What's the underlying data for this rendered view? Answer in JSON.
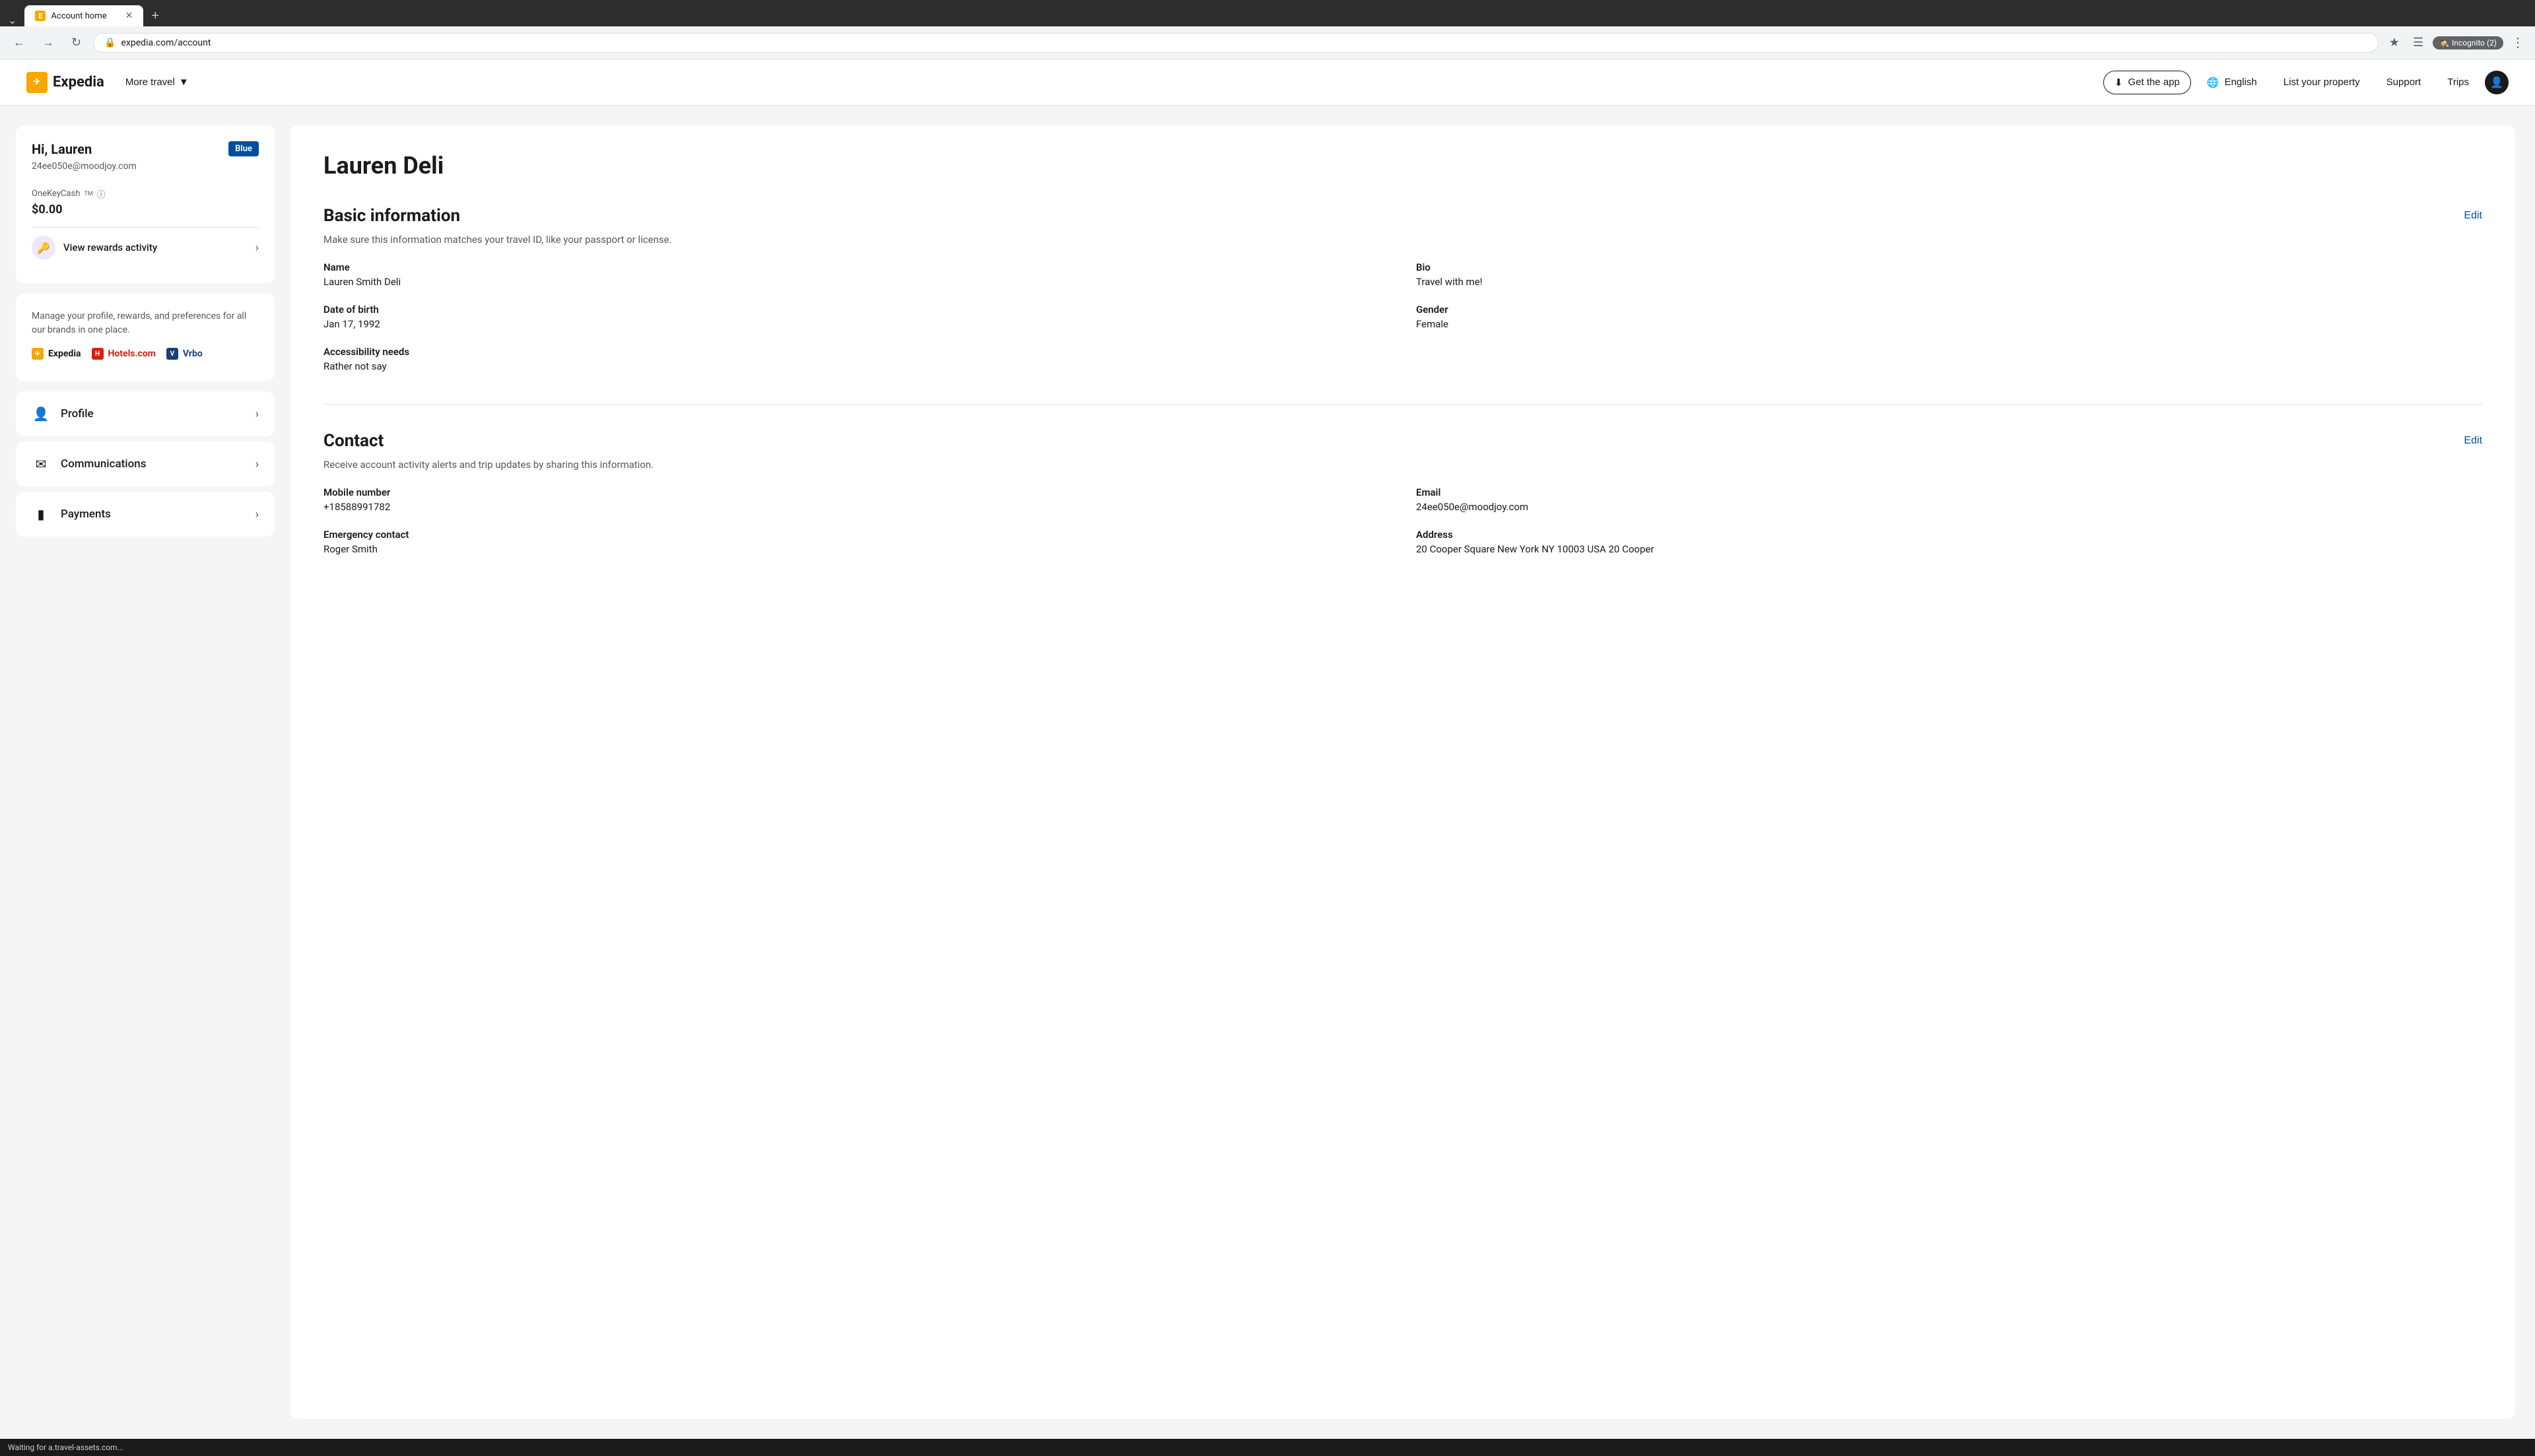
{
  "browser": {
    "tabs": [
      {
        "label": "Account home",
        "active": true,
        "favicon": "E"
      }
    ],
    "url": "expedia.com/account",
    "incognito_label": "Incognito (2)"
  },
  "header": {
    "logo_text": "Expedia",
    "more_travel": "More travel",
    "get_app": "Get the app",
    "language": "English",
    "list_property": "List your property",
    "support": "Support",
    "trips": "Trips"
  },
  "sidebar": {
    "greeting": "Hi, Lauren",
    "email": "24ee050e@moodjoy.com",
    "badge": "Blue",
    "onekeycash_label": "OneKeyCash",
    "onekeycash_amount": "$0.00",
    "rewards_link": "View rewards activity",
    "manage_text": "Manage your profile, rewards, and preferences for all our brands in one place.",
    "brands": [
      "Expedia",
      "Hotels.com",
      "Vrbo"
    ],
    "nav_items": [
      {
        "label": "Profile",
        "icon": "person"
      },
      {
        "label": "Communications",
        "icon": "email"
      },
      {
        "label": "Payments",
        "icon": "card"
      }
    ]
  },
  "profile": {
    "name": "Lauren Deli",
    "basic_info": {
      "section_title": "Basic information",
      "section_subtitle": "Make sure this information matches your travel ID, like your passport or license.",
      "edit_label": "Edit",
      "fields": [
        {
          "label": "Name",
          "value": "Lauren Smith Deli",
          "col": "left"
        },
        {
          "label": "Bio",
          "value": "Travel with me!",
          "col": "right"
        },
        {
          "label": "Date of birth",
          "value": "Jan 17, 1992",
          "col": "left"
        },
        {
          "label": "Gender",
          "value": "Female",
          "col": "right"
        },
        {
          "label": "Accessibility needs",
          "value": "Rather not say",
          "col": "left"
        }
      ]
    },
    "contact": {
      "section_title": "Contact",
      "section_subtitle": "Receive account activity alerts and trip updates by sharing this information.",
      "edit_label": "Edit",
      "fields": [
        {
          "label": "Mobile number",
          "value": "+18588991782",
          "col": "left"
        },
        {
          "label": "Email",
          "value": "24ee050e@moodjoy.com",
          "col": "right"
        },
        {
          "label": "Emergency contact",
          "value": "Roger Smith",
          "col": "left"
        },
        {
          "label": "Address",
          "value": "20 Cooper Square New York NY 10003 USA 20 Cooper",
          "col": "right"
        }
      ]
    }
  },
  "status_bar": {
    "text": "Waiting for a.travel-assets.com..."
  }
}
